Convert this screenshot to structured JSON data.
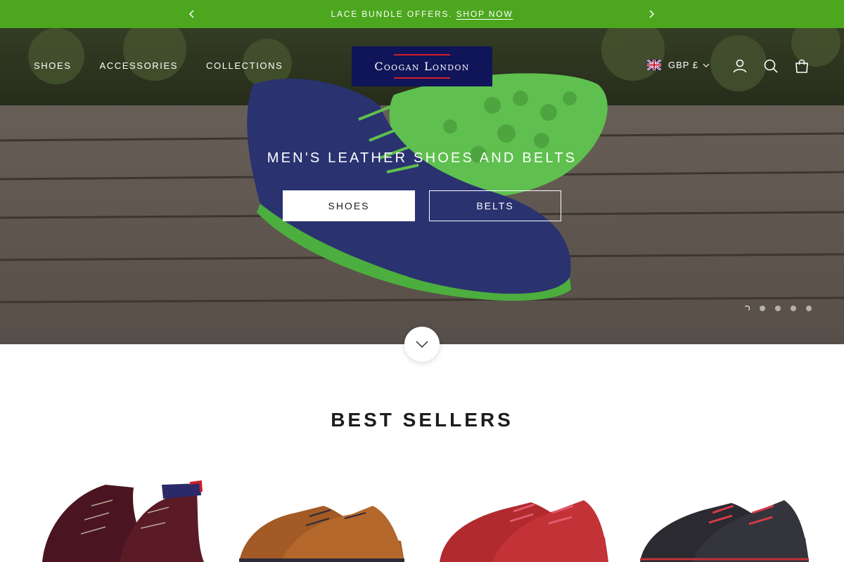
{
  "announcement": {
    "text": "LACE BUNDLE OFFERS.",
    "link": "SHOP NOW"
  },
  "header": {
    "nav": [
      "SHOES",
      "ACCESSORIES",
      "COLLECTIONS"
    ],
    "logo_text": "Coogan London",
    "currency": "GBP £",
    "icons": [
      "account-icon",
      "search-icon",
      "cart-icon"
    ]
  },
  "hero": {
    "title": "MEN'S LEATHER SHOES AND BELTS",
    "buttons": [
      "SHOES",
      "BELTS"
    ],
    "slides_count": 5,
    "active_slide": 1
  },
  "best_sellers": {
    "title": "BEST SELLERS"
  },
  "colors": {
    "announcement_bg": "#4ca71e",
    "logo_bg": "#101459",
    "logo_accent": "#d21f2a"
  }
}
